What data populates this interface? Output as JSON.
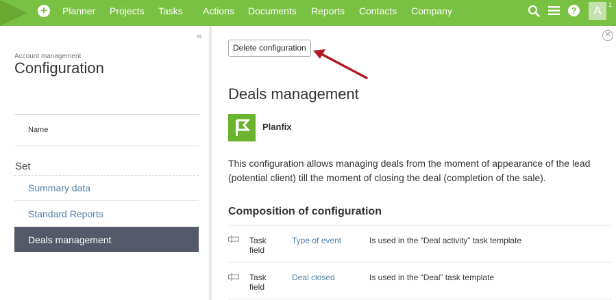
{
  "topbar": {
    "nav": [
      "Planner",
      "Projects",
      "Tasks",
      "Actions",
      "Documents",
      "Reports",
      "Contacts",
      "Company"
    ],
    "avatar_letter": "A",
    "avatar_badge": "1",
    "icons": [
      "plus-icon",
      "search-icon",
      "menu-icon",
      "help-icon"
    ],
    "color": "#79c142"
  },
  "sidebar": {
    "collapse_glyph": "«",
    "breadcrumb": "Account management",
    "title": "Configuration",
    "name_label": "Name",
    "set_label": "Set",
    "items": [
      {
        "label": "Summary data",
        "active": false
      },
      {
        "label": "Standard Reports",
        "active": false
      },
      {
        "label": "Deals management",
        "active": true
      }
    ],
    "active_color": "#535968",
    "link_color": "#4f7ea5"
  },
  "main": {
    "delete_button": "Delete configuration",
    "heading": "Deals management",
    "vendor": "Planfix",
    "description": "This configuration allows managing deals from the moment of appearance of the lead (potential client) till the moment of closing the deal (completion of the sale).",
    "section_title": "Composition of configuration",
    "rows": [
      {
        "type_line1": "Task",
        "type_line2": "field",
        "name": "Type of event",
        "usage": "Is used in the “Deal activity” task template"
      },
      {
        "type_line1": "Task",
        "type_line2": "field",
        "name": "Deal closed",
        "usage": "Is used in the “Deal” task template"
      }
    ],
    "arrow_color": "#b01a24"
  }
}
